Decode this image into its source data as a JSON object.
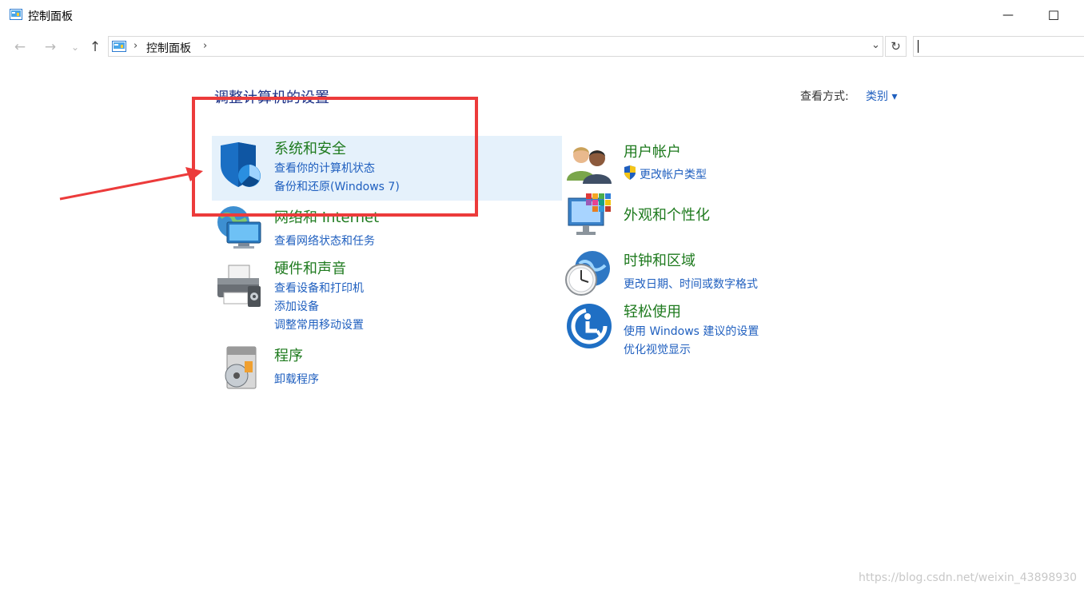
{
  "window": {
    "title": "控制面板",
    "minimize": "—",
    "maximize": "☐"
  },
  "nav": {
    "back": "←",
    "forward": "→",
    "recent": "⌄",
    "up": "↑",
    "breadcrumb": "控制面板",
    "sep1": "›",
    "sep2": "›",
    "dropdown": "⌄",
    "refresh": "↻",
    "search_value": ""
  },
  "main": {
    "heading": "调整计算机的设置",
    "view_by_label": "查看方式:",
    "view_by_value": "类别 ▾"
  },
  "categories_left": [
    {
      "icon": "shield-icon",
      "title": "系统和安全",
      "links": [
        "查看你的计算机状态",
        "备份和还原(Windows 7)"
      ]
    },
    {
      "icon": "network-icon",
      "title": "网络和 Internet",
      "links": [
        "查看网络状态和任务"
      ]
    },
    {
      "icon": "printer-icon",
      "title": "硬件和声音",
      "links": [
        "查看设备和打印机",
        "添加设备",
        "调整常用移动设置"
      ]
    },
    {
      "icon": "programs-icon",
      "title": "程序",
      "links": [
        "卸载程序"
      ]
    }
  ],
  "categories_right": [
    {
      "icon": "users-icon",
      "title": "用户帐户",
      "links": [
        "更改帐户类型"
      ]
    },
    {
      "icon": "appearance-icon",
      "title": "外观和个性化",
      "links": []
    },
    {
      "icon": "clock-globe-icon",
      "title": "时钟和区域",
      "links": [
        "更改日期、时间或数字格式"
      ]
    },
    {
      "icon": "accessibility-icon",
      "title": "轻松使用",
      "links": [
        "使用 Windows 建议的设置",
        "优化视觉显示"
      ]
    }
  ],
  "watermark": "https://blog.csdn.net/weixin_43898930",
  "colors": {
    "accent_link": "#1f5fbf",
    "category_title": "#1e7a1e",
    "heading": "#1e3287",
    "highlight_bg": "#e5f1fb",
    "annotation_red": "#ec3b3b"
  }
}
